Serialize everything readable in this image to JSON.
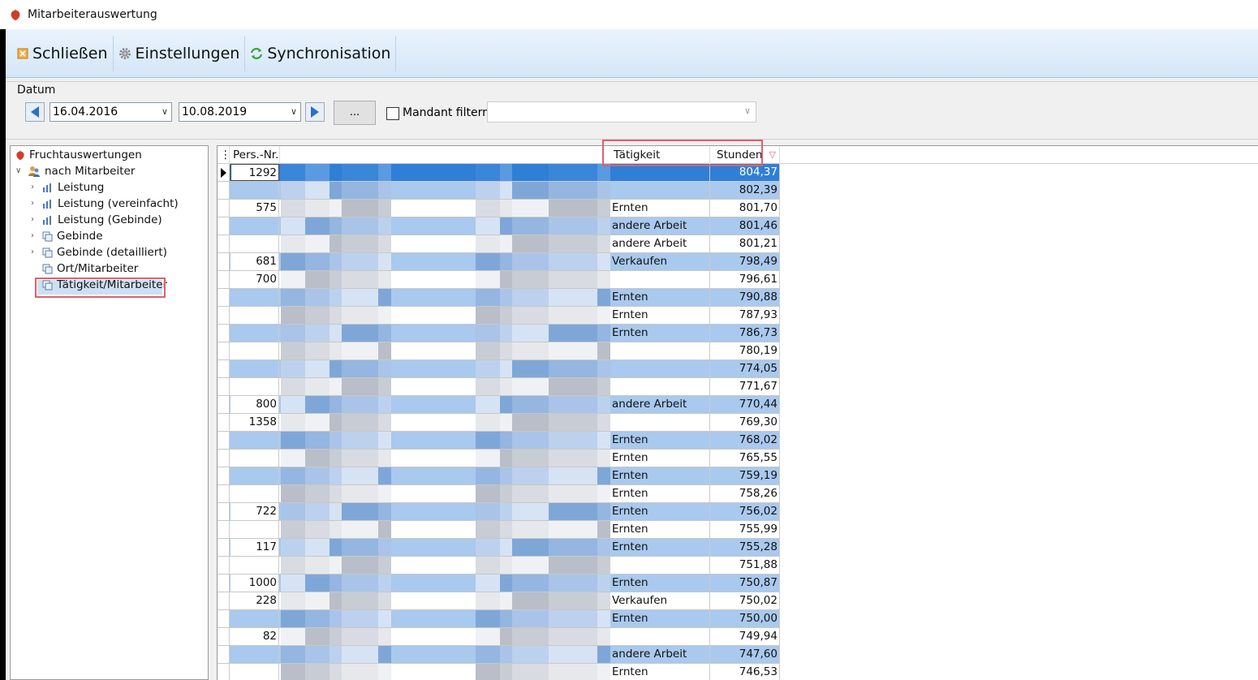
{
  "window": {
    "title": "Mitarbeiterauswertung"
  },
  "toolbar": {
    "close_label": "Schließen",
    "settings_label": "Einstellungen",
    "sync_label": "Synchronisation"
  },
  "filter": {
    "group_label": "Datum",
    "date_from": "16.04.2016",
    "date_to": "10.08.2019",
    "ellipsis_label": "...",
    "mandant_label": "Mandant filtern",
    "mandant_value": ""
  },
  "tree": {
    "root": "Fruchtauswertungen",
    "group": "nach Mitarbeiter",
    "items": [
      "Leistung",
      "Leistung (vereinfacht)",
      "Leistung (Gebinde)",
      "Gebinde",
      "Gebinde (detailliert)",
      "Ort/Mitarbeiter",
      "Tätigkeit/Mitarbeiter"
    ]
  },
  "grid": {
    "headers": {
      "pers": "Pers.-Nr.",
      "taetigkeit": "Tätigkeit",
      "stunden": "Stunden"
    },
    "rows": [
      {
        "pers": "1292",
        "taetigkeit": "",
        "stunden": "804,37"
      },
      {
        "pers": "",
        "taetigkeit": "",
        "stunden": "802,39"
      },
      {
        "pers": "575",
        "taetigkeit": "Ernten",
        "stunden": "801,70"
      },
      {
        "pers": "",
        "taetigkeit": "andere Arbeit",
        "stunden": "801,46"
      },
      {
        "pers": "",
        "taetigkeit": "andere Arbeit",
        "stunden": "801,21"
      },
      {
        "pers": "681",
        "taetigkeit": "Verkaufen",
        "stunden": "798,49"
      },
      {
        "pers": "700",
        "taetigkeit": "",
        "stunden": "796,61"
      },
      {
        "pers": "",
        "taetigkeit": "Ernten",
        "stunden": "790,88"
      },
      {
        "pers": "",
        "taetigkeit": "Ernten",
        "stunden": "787,93"
      },
      {
        "pers": "",
        "taetigkeit": "Ernten",
        "stunden": "786,73"
      },
      {
        "pers": "",
        "taetigkeit": "",
        "stunden": "780,19"
      },
      {
        "pers": "",
        "taetigkeit": "",
        "stunden": "774,05"
      },
      {
        "pers": "",
        "taetigkeit": "",
        "stunden": "771,67"
      },
      {
        "pers": "800",
        "taetigkeit": "andere Arbeit",
        "stunden": "770,44"
      },
      {
        "pers": "1358",
        "taetigkeit": "",
        "stunden": "769,30"
      },
      {
        "pers": "",
        "taetigkeit": "Ernten",
        "stunden": "768,02"
      },
      {
        "pers": "",
        "taetigkeit": "Ernten",
        "stunden": "765,55"
      },
      {
        "pers": "",
        "taetigkeit": "Ernten",
        "stunden": "759,19"
      },
      {
        "pers": "",
        "taetigkeit": "Ernten",
        "stunden": "758,26"
      },
      {
        "pers": "722",
        "taetigkeit": "Ernten",
        "stunden": "756,02"
      },
      {
        "pers": "",
        "taetigkeit": "Ernten",
        "stunden": "755,99"
      },
      {
        "pers": "117",
        "taetigkeit": "Ernten",
        "stunden": "755,28"
      },
      {
        "pers": "",
        "taetigkeit": "",
        "stunden": "751,88"
      },
      {
        "pers": "1000",
        "taetigkeit": "Ernten",
        "stunden": "750,87"
      },
      {
        "pers": "228",
        "taetigkeit": "Verkaufen",
        "stunden": "750,02"
      },
      {
        "pers": "",
        "taetigkeit": "Ernten",
        "stunden": "750,00"
      },
      {
        "pers": "82",
        "taetigkeit": "",
        "stunden": "749,94"
      },
      {
        "pers": "",
        "taetigkeit": "andere Arbeit",
        "stunden": "747,60"
      },
      {
        "pers": "",
        "taetigkeit": "Ernten",
        "stunden": "746,53"
      }
    ]
  },
  "icons": {
    "app": "strawberry-icon",
    "close": "close-icon",
    "settings": "gear-icon",
    "sync": "sync-icon",
    "prev": "arrow-left-icon",
    "next": "arrow-right-icon",
    "sort": "sort-filter-icon"
  },
  "colors": {
    "selected_row": "#2f7fd6",
    "alt_row": "#a9c9ee",
    "highlight_box": "#e0606a",
    "toolbar_bg": "#d4e6f8"
  }
}
